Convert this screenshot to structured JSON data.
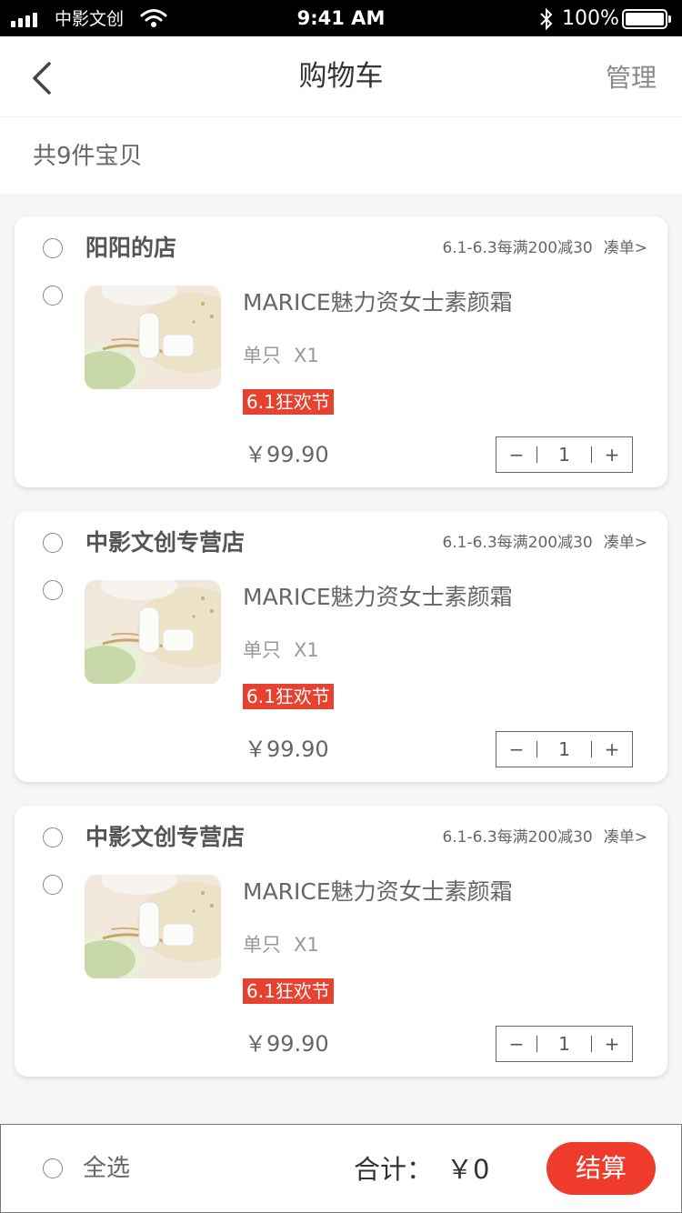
{
  "status_bar": {
    "carrier": "中影文创",
    "time": "9:41 AM",
    "battery": "100%"
  },
  "nav": {
    "title": "购物车",
    "manage_label": "管理"
  },
  "summary": {
    "count_text": "共9件宝贝"
  },
  "stores": [
    {
      "name": "阳阳的店",
      "promo": "6.1-6.3每满200减30",
      "promo_link": "凑单>",
      "item": {
        "title": "MARICE魅力资女士素颜霜",
        "spec_unit": "单只",
        "spec_qty": "X1",
        "tag": "6.1狂欢节",
        "price": "￥99.90",
        "quantity": "1"
      }
    },
    {
      "name": "中影文创专营店",
      "promo": "6.1-6.3每满200减30",
      "promo_link": "凑单>",
      "item": {
        "title": "MARICE魅力资女士素颜霜",
        "spec_unit": "单只",
        "spec_qty": "X1",
        "tag": "6.1狂欢节",
        "price": "￥99.90",
        "quantity": "1"
      }
    },
    {
      "name": "中影文创专营店",
      "promo": "6.1-6.3每满200减30",
      "promo_link": "凑单>",
      "item": {
        "title": "MARICE魅力资女士素颜霜",
        "spec_unit": "单只",
        "spec_qty": "X1",
        "tag": "6.1狂欢节",
        "price": "￥99.90",
        "quantity": "1"
      }
    }
  ],
  "stepper_labels": {
    "minus": "−",
    "plus": "+"
  },
  "footer": {
    "select_all_label": "全选",
    "total_label": "合计：",
    "total_value": "￥0",
    "checkout_label": "结算"
  },
  "colors": {
    "accent": "#ef3b2c",
    "tag_bg": "#e8412f"
  }
}
